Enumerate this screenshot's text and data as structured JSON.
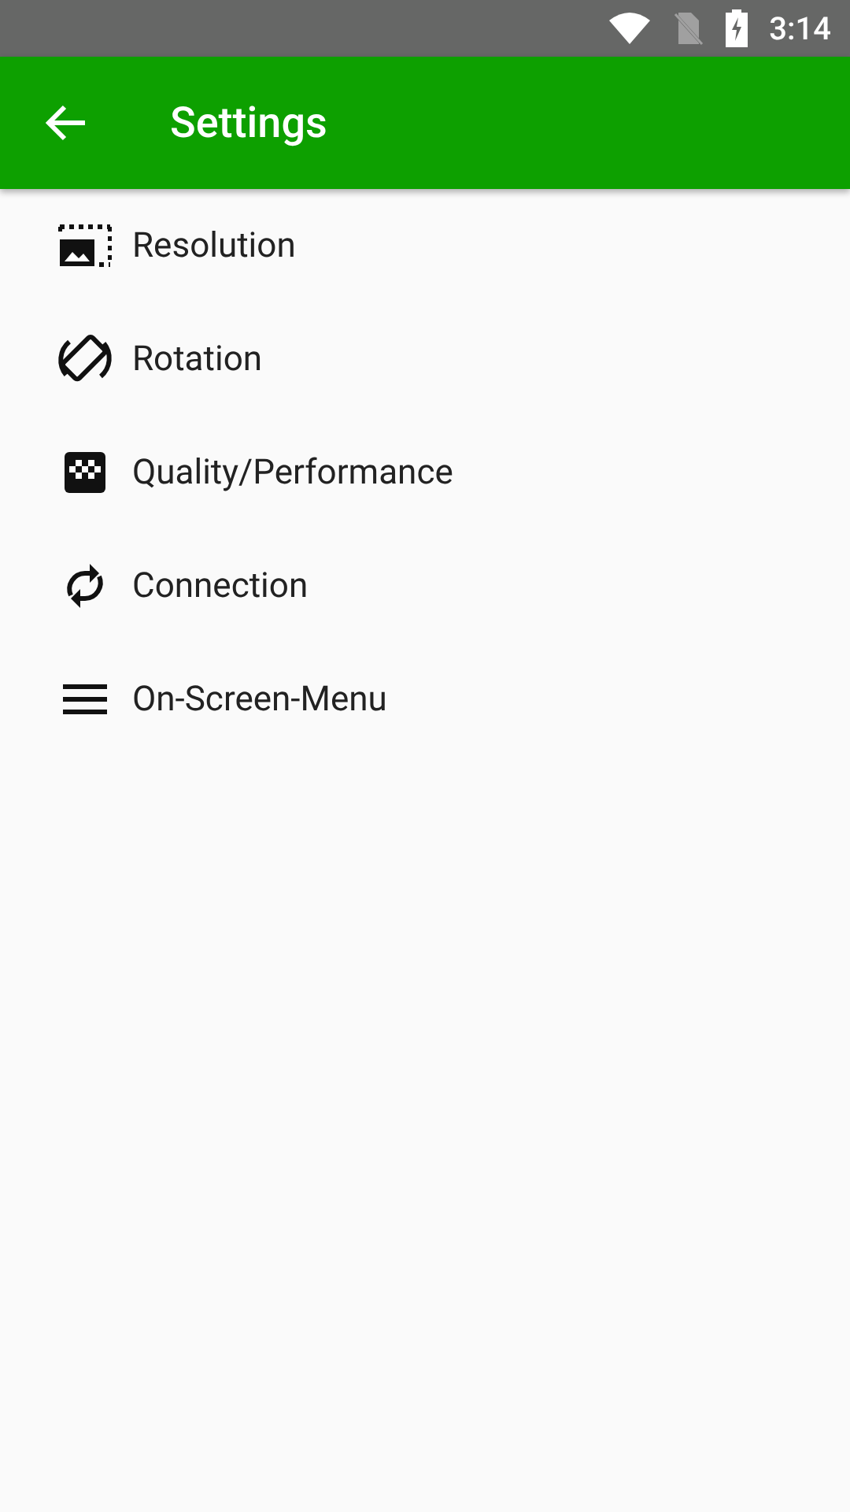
{
  "status_bar": {
    "time": "3:14"
  },
  "app_bar": {
    "title": "Settings"
  },
  "items": [
    {
      "kind": "resolution",
      "label": "Resolution"
    },
    {
      "kind": "rotation",
      "label": "Rotation"
    },
    {
      "kind": "quality",
      "label": "Quality/Performance"
    },
    {
      "kind": "connection",
      "label": "Connection"
    },
    {
      "kind": "menu",
      "label": "On-Screen-Menu"
    }
  ]
}
